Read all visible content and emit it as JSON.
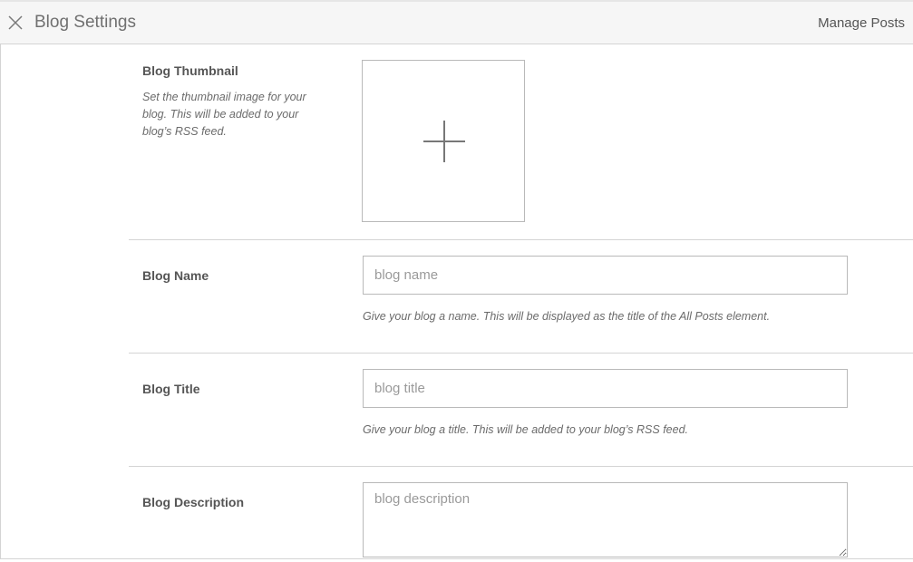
{
  "header": {
    "title": "Blog Settings",
    "close_icon": "close-icon",
    "manage_posts_label": "Manage Posts"
  },
  "thumbnail": {
    "label": "Blog Thumbnail",
    "description": "Set the thumbnail image for your blog. This will be added to your blog’s RSS feed.",
    "add_icon": "plus-icon"
  },
  "name": {
    "label": "Blog Name",
    "placeholder": "blog name",
    "value": "",
    "help": "Give your blog a name. This will be displayed as the title of the All Posts element."
  },
  "title": {
    "label": "Blog Title",
    "placeholder": "blog title",
    "value": "",
    "help": "Give your blog a title. This will be added to your blog’s RSS feed."
  },
  "description": {
    "label": "Blog Description",
    "placeholder": "blog description",
    "value": ""
  },
  "colors": {
    "header_bg": "#f6f6f6",
    "border": "#d4d4d4",
    "input_border": "#b9b9b9",
    "text": "#555555"
  }
}
